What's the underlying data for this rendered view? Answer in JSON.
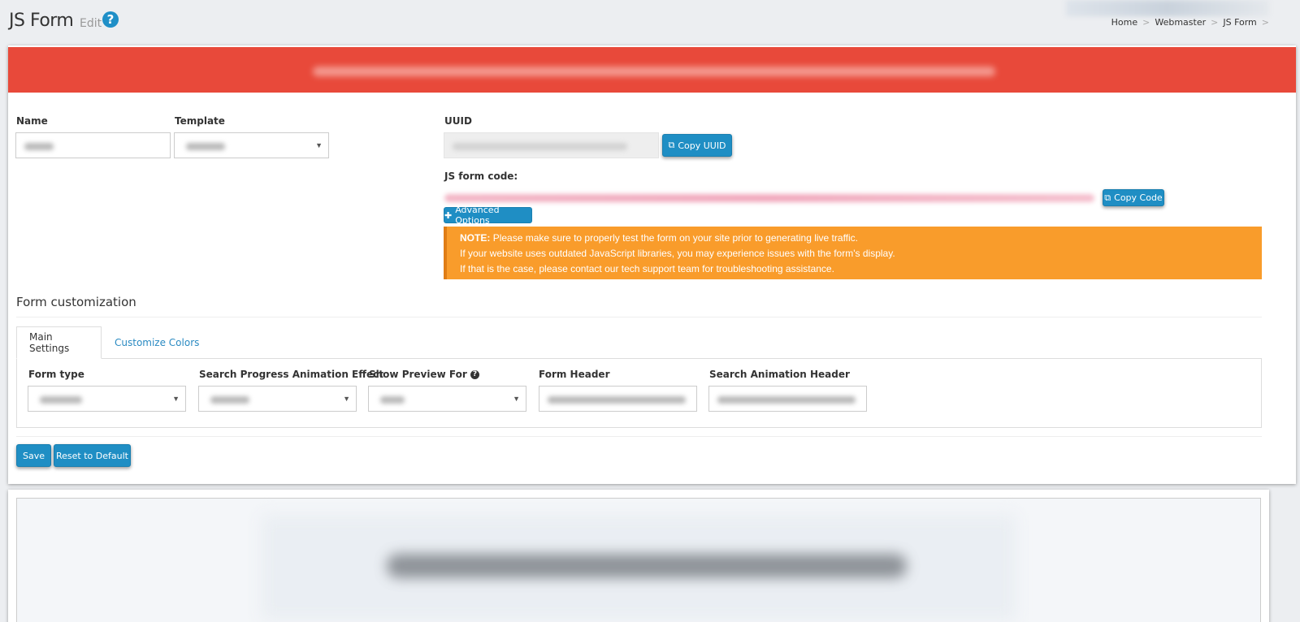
{
  "header": {
    "title": "JS Form",
    "subtitle": "Edit",
    "help_icon": "?",
    "breadcrumb": [
      "Home",
      "Webmaster",
      "JS Form"
    ],
    "breadcrumb_sep": ">"
  },
  "form": {
    "name_label": "Name",
    "template_label": "Template",
    "uuid_label": "UUID",
    "copy_uuid_label": "Copy UUID",
    "code_label": "JS form code:",
    "copy_code_label": "Copy Code",
    "advanced_label": "Advanced Options",
    "note": {
      "prefix": "NOTE:",
      "line1": "Please make sure to properly test the form on your site prior to generating live traffic.",
      "line2": "If your website uses outdated JavaScript libraries, you may experience issues with the form's display.",
      "line3": "If that is the case, please contact our tech support team for troubleshooting assistance."
    }
  },
  "customization": {
    "title": "Form customization",
    "tabs": [
      {
        "label": "Main Settings"
      },
      {
        "label": "Customize Colors"
      }
    ],
    "fields": {
      "form_type_label": "Form type",
      "animation_label": "Search Progress Animation Effect",
      "preview_label": "Show Preview For",
      "form_header_label": "Form Header",
      "animation_header_label": "Search Animation Header"
    }
  },
  "actions": {
    "save_label": "Save",
    "reset_label": "Reset to Default"
  },
  "colors": {
    "primary": "#1f8ec4",
    "alert_red": "#e8493a",
    "note_orange": "#f99c2b"
  }
}
